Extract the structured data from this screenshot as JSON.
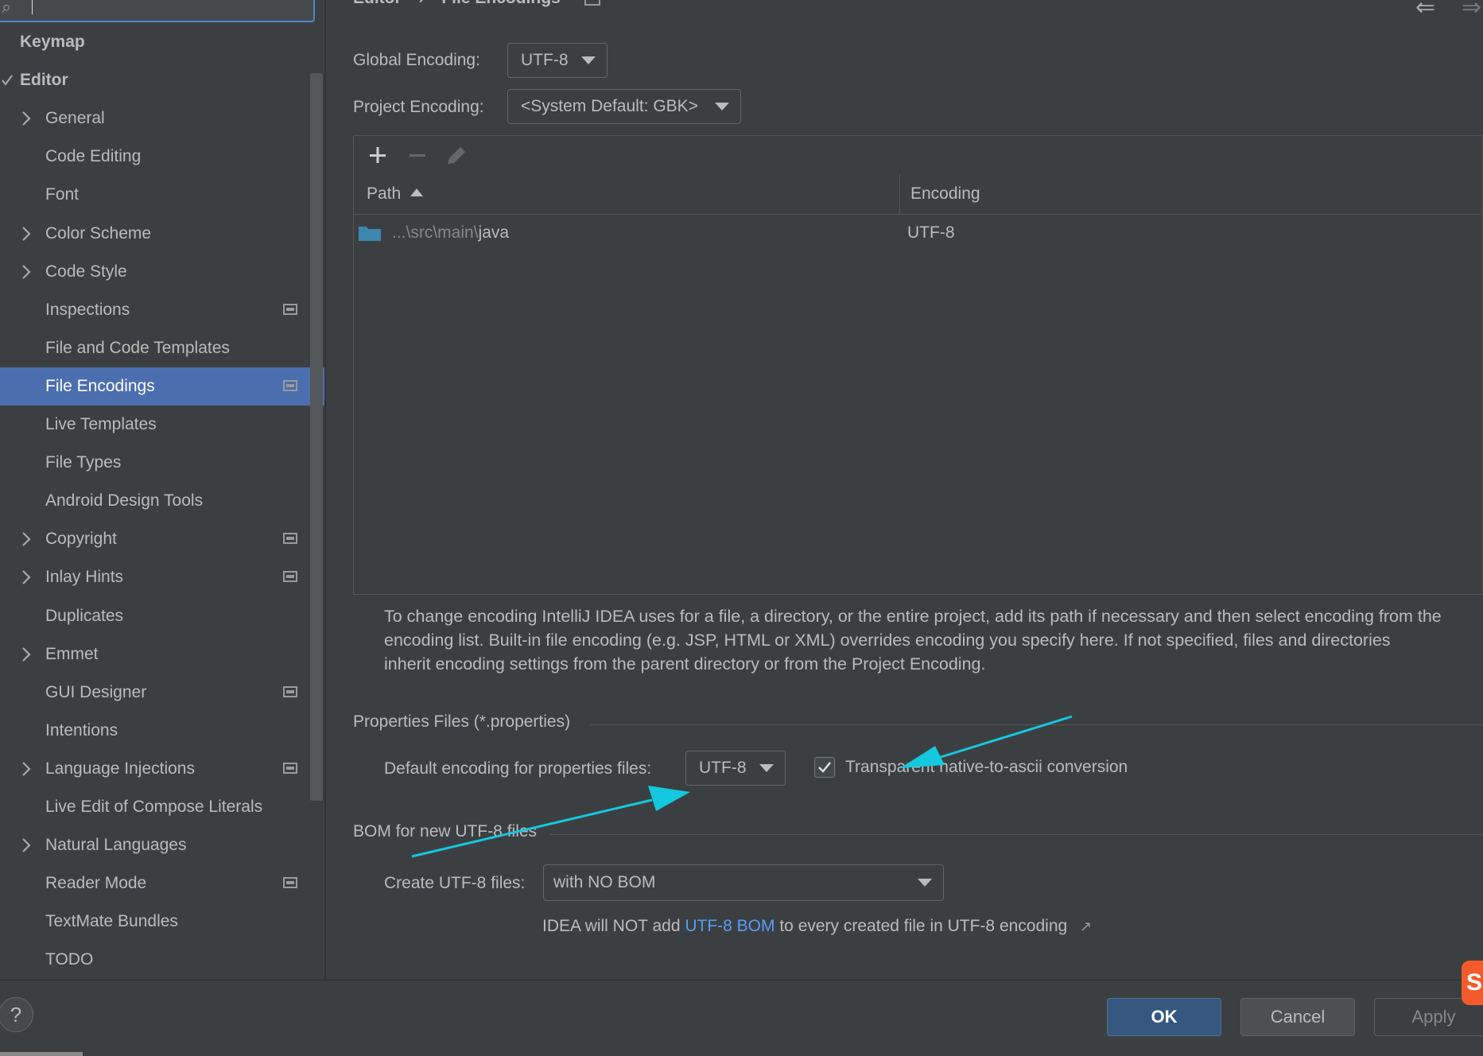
{
  "header": {
    "breadcrumb_parent": "Editor",
    "breadcrumb_sep": "›",
    "breadcrumb_current": "File Encodings"
  },
  "sidebar": {
    "items": [
      {
        "label": "Keymap",
        "level": "top"
      },
      {
        "label": "Editor",
        "level": "top",
        "expanded": true
      },
      {
        "label": "General",
        "chevron": true
      },
      {
        "label": "Code Editing"
      },
      {
        "label": "Font"
      },
      {
        "label": "Color Scheme",
        "chevron": true
      },
      {
        "label": "Code Style",
        "chevron": true
      },
      {
        "label": "Inspections",
        "project_icon": true
      },
      {
        "label": "File and Code Templates"
      },
      {
        "label": "File Encodings",
        "project_icon": true,
        "selected": true
      },
      {
        "label": "Live Templates"
      },
      {
        "label": "File Types"
      },
      {
        "label": "Android Design Tools"
      },
      {
        "label": "Copyright",
        "chevron": true,
        "project_icon": true
      },
      {
        "label": "Inlay Hints",
        "chevron": true,
        "project_icon": true
      },
      {
        "label": "Duplicates"
      },
      {
        "label": "Emmet",
        "chevron": true
      },
      {
        "label": "GUI Designer",
        "project_icon": true
      },
      {
        "label": "Intentions"
      },
      {
        "label": "Language Injections",
        "chevron": true,
        "project_icon": true
      },
      {
        "label": "Live Edit of Compose Literals"
      },
      {
        "label": "Natural Languages",
        "chevron": true
      },
      {
        "label": "Reader Mode",
        "project_icon": true
      },
      {
        "label": "TextMate Bundles"
      },
      {
        "label": "TODO"
      }
    ]
  },
  "main": {
    "global_encoding_label": "Global Encoding:",
    "global_encoding_value": "UTF-8",
    "project_encoding_label": "Project Encoding:",
    "project_encoding_value": "<System Default: GBK>",
    "table": {
      "columns": [
        "Path",
        "Encoding"
      ],
      "rows": [
        {
          "path_prefix": "...\\src\\main\\",
          "path_name": "java",
          "encoding": "UTF-8"
        }
      ]
    },
    "help_text": "To change encoding IntelliJ IDEA uses for a file, a directory, or the entire project, add its path if necessary and then select encoding from the encoding list. Built-in file encoding (e.g. JSP, HTML or XML) overrides encoding you specify here. If not specified, files and directories inherit encoding settings from the parent directory or from the Project Encoding.",
    "properties_section": "Properties Files (*.properties)",
    "default_encoding_label": "Default encoding for properties files:",
    "default_encoding_value": "UTF-8",
    "transparent_label": "Transparent native-to-ascii conversion",
    "transparent_checked": true,
    "bom_section": "BOM for new UTF-8 files",
    "create_utf8_label": "Create UTF-8 files:",
    "create_utf8_value": "with NO BOM",
    "bom_note_prefix": "IDEA will NOT add ",
    "bom_note_link": "UTF-8 BOM",
    "bom_note_suffix": " to every created file in UTF-8 encoding",
    "bom_note_ext": "↗"
  },
  "footer": {
    "help": "?",
    "ok": "OK",
    "cancel": "Cancel",
    "apply": "Apply"
  },
  "badge": "S",
  "colors": {
    "background": "#3c3f41",
    "selection": "#4b6eaf",
    "ok_button": "#365880",
    "link": "#589df6",
    "annotation_arrow": "#14c8e0"
  }
}
